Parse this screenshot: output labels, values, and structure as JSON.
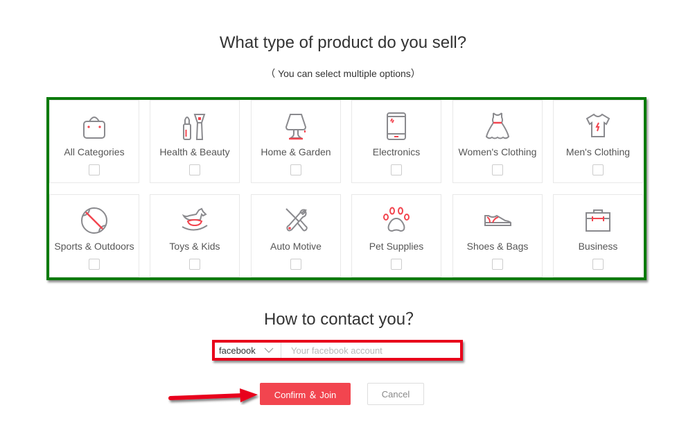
{
  "header": {
    "title": "What type of product do you sell?",
    "subtitle": "（ You can select multiple options）"
  },
  "categories": [
    {
      "label": "All Categories",
      "icon": "shopping-bag-icon",
      "checked": false
    },
    {
      "label": "Health & Beauty",
      "icon": "lipstick-brush-icon",
      "checked": false
    },
    {
      "label": "Home & Garden",
      "icon": "lamp-icon",
      "checked": false
    },
    {
      "label": "Electronics",
      "icon": "tablet-icon",
      "checked": false
    },
    {
      "label": "Women's Clothing",
      "icon": "dress-icon",
      "checked": false
    },
    {
      "label": "Men's Clothing",
      "icon": "tshirt-icon",
      "checked": false
    },
    {
      "label": "Sports & Outdoors",
      "icon": "baseball-icon",
      "checked": false
    },
    {
      "label": "Toys & Kids",
      "icon": "rocking-horse-icon",
      "checked": false
    },
    {
      "label": "Auto Motive",
      "icon": "wrench-screwdriver-icon",
      "checked": false
    },
    {
      "label": "Pet Supplies",
      "icon": "paw-icon",
      "checked": false
    },
    {
      "label": "Shoes & Bags",
      "icon": "sneaker-icon",
      "checked": false
    },
    {
      "label": "Business",
      "icon": "briefcase-icon",
      "checked": false
    }
  ],
  "contact": {
    "title": "How to contact you？",
    "method_selected": "facebook",
    "account_value": "",
    "account_placeholder": "Your facebook account"
  },
  "actions": {
    "confirm_label": "Confirm ＆ Join",
    "cancel_label": "Cancel"
  },
  "annotations": {
    "grid_highlight_color": "#0a7a0a",
    "contact_highlight_color": "#e8001a",
    "arrow_color": "#e8001a"
  },
  "colors": {
    "accent": "#f2454f",
    "icon_stroke": "#8a8a8e",
    "icon_accent": "#f2454f"
  }
}
